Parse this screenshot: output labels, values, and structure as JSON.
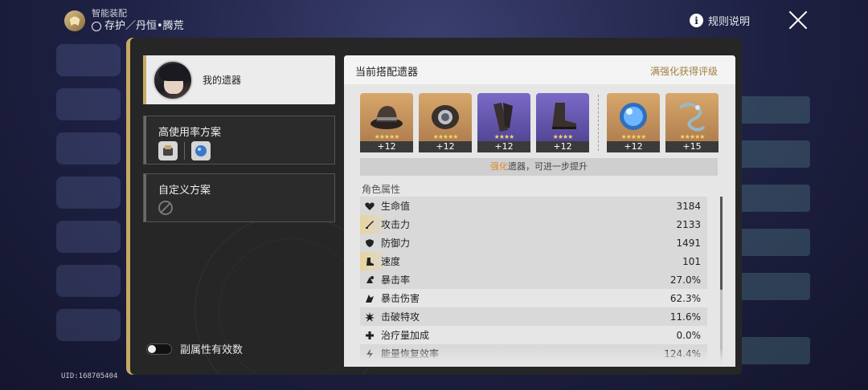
{
  "header": {
    "subtitle": "智能装配",
    "path": "存护／丹恒•腾荒",
    "rules_label": "规则说明",
    "uid": "UID:168705404"
  },
  "left_panel": {
    "my_relics_label": "我的遗器",
    "high_usage_title": "高使用率方案",
    "custom_title": "自定义方案",
    "toggle_label": "副属性有效数",
    "toggle_on": false
  },
  "right_panel": {
    "title": "当前搭配遗器",
    "grade_label": "满强化获得评级",
    "relics": [
      {
        "name": "hat-relic-icon",
        "rarity": "gold",
        "stars": "★★★★★",
        "level": "+12"
      },
      {
        "name": "gloves-relic-icon",
        "rarity": "gold",
        "stars": "★★★★★",
        "level": "+12"
      },
      {
        "name": "body-relic-icon",
        "rarity": "purple",
        "stars": "★★★★",
        "level": "+12"
      },
      {
        "name": "boots-relic-icon",
        "rarity": "purple",
        "stars": "★★★★",
        "level": "+12"
      },
      {
        "name": "sphere-relic-icon",
        "rarity": "gold",
        "stars": "★★★★★",
        "level": "+12"
      },
      {
        "name": "rope-relic-icon",
        "rarity": "gold",
        "stars": "★★★★★",
        "level": "+15"
      }
    ],
    "upgrade_hint_highlight": "强化",
    "upgrade_hint_rest": "遗器，可进一步提升",
    "attr_section_title": "角色属性",
    "attributes": [
      {
        "icon": "heart-icon",
        "name": "生命值",
        "value": "3184",
        "highlight": false
      },
      {
        "icon": "sword-icon",
        "name": "攻击力",
        "value": "2133",
        "highlight": true
      },
      {
        "icon": "shield-icon",
        "name": "防御力",
        "value": "1491",
        "highlight": false
      },
      {
        "icon": "boot-icon",
        "name": "速度",
        "value": "101",
        "highlight": true
      },
      {
        "icon": "crit-rate-icon",
        "name": "暴击率",
        "value": "27.0%",
        "highlight": false
      },
      {
        "icon": "crit-dmg-icon",
        "name": "暴击伤害",
        "value": "62.3%",
        "highlight": false
      },
      {
        "icon": "break-icon",
        "name": "击破特攻",
        "value": "11.6%",
        "highlight": false
      },
      {
        "icon": "cross-icon",
        "name": "治疗量加成",
        "value": "0.0%",
        "highlight": false
      },
      {
        "icon": "energy-icon",
        "name": "能量恢复效率",
        "value": "124.4%",
        "highlight": false
      }
    ],
    "scroll_fraction": 0.55
  },
  "colors": {
    "gold_accent": "#c9a866",
    "highlight_orange": "#e08a2a",
    "grade_text": "#a08040"
  }
}
